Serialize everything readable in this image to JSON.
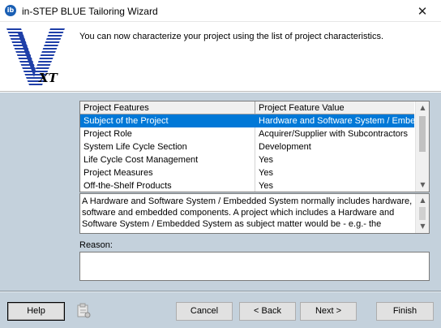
{
  "window": {
    "title": "in-STEP BLUE Tailoring Wizard",
    "app_icon": "ib",
    "close_glyph": "✕"
  },
  "header": {
    "logo_mark": "V",
    "logo_subtext": "XT",
    "instruction": "You can now characterize your project using the list of project characteristics."
  },
  "grid": {
    "columns": [
      "Project Features",
      "Project Feature Value"
    ],
    "rows": [
      {
        "feature": "Subject of the Project",
        "value": "Hardware and Software System / Embedded",
        "selected": true
      },
      {
        "feature": "Project Role",
        "value": "Acquirer/Supplier with Subcontractors",
        "selected": false
      },
      {
        "feature": "System Life Cycle Section",
        "value": "Development",
        "selected": false
      },
      {
        "feature": "Life Cycle Cost Management",
        "value": "Yes",
        "selected": false
      },
      {
        "feature": "Project Measures",
        "value": "Yes",
        "selected": false
      },
      {
        "feature": "Off-the-Shelf Products",
        "value": "Yes",
        "selected": false
      }
    ]
  },
  "description": {
    "text": "A Hardware and Software System / Embedded System normally includes hardware, software and embedded components. A project which includes a Hardware and Software System / Embedded System as subject matter would be - e.g.- the"
  },
  "reason": {
    "label": "Reason:",
    "value": ""
  },
  "buttons": {
    "help": "Help",
    "cancel": "Cancel",
    "back": "< Back",
    "next": "Next >",
    "finish": "Finish"
  },
  "colors": {
    "accent": "#0078d7",
    "body_bg": "#c4d1dc",
    "logo_blue": "#1f3fa8"
  }
}
